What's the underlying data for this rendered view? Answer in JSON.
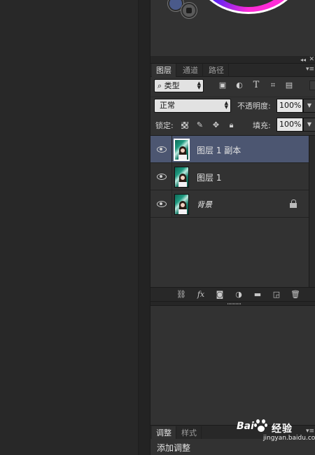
{
  "panel": {
    "tabs": [
      "图层",
      "通道",
      "路径"
    ],
    "filter": {
      "label": "类型"
    },
    "blend_mode": "正常",
    "opacity": {
      "label": "不透明度:",
      "value": "100%"
    },
    "lock": {
      "label": "锁定:"
    },
    "fill": {
      "label": "填充:",
      "value": "100%"
    }
  },
  "layers": [
    {
      "name": "图层 1 副本",
      "visible": true,
      "selected": true
    },
    {
      "name": "图层 1",
      "visible": true,
      "selected": false
    },
    {
      "name": "背景",
      "visible": true,
      "selected": false,
      "locked": true
    }
  ],
  "toolbar": {
    "fx_label": "fx"
  },
  "adjustments_panel": {
    "tabs": [
      "调整",
      "样式"
    ],
    "heading": "添加调整"
  },
  "watermark": {
    "brand": "Bai",
    "name": "经验",
    "url": "jingyan.baidu.com"
  },
  "colors": {
    "selected_layer": "#4c5671",
    "panel_bg": "#323232",
    "dark_bg": "#282828"
  }
}
